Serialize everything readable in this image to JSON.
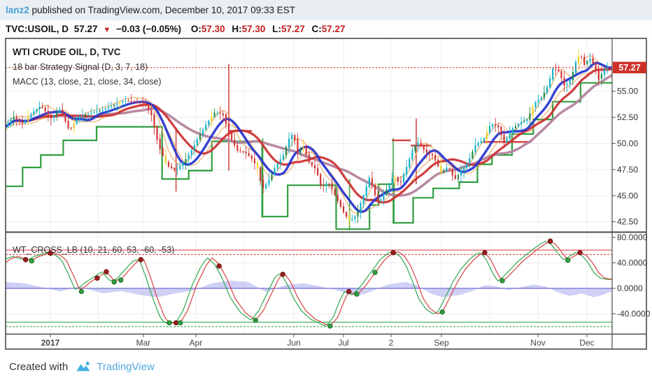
{
  "header": {
    "username": "lanz2",
    "published_text": " published on TradingView.com, December 10, 2017 09:33 EST"
  },
  "ticker": {
    "symbol": "TVC:USOIL, D",
    "last": "57.27",
    "direction": "▼",
    "change": "−0.03 (−0.05%)",
    "open_label": "O:",
    "open": "57.30",
    "high_label": "H:",
    "high": "57.30",
    "low_label": "L:",
    "low": "57.27",
    "close_label": "C:",
    "close": "57.27"
  },
  "footer": {
    "created_with": "Created with",
    "brand": "TradingView"
  },
  "colors": {
    "accent_red": "#c51f1f",
    "badge_red": "#cf3129",
    "up_teal": "#12b2ca",
    "up_green": "#1e8c4f",
    "down_red": "#d23535",
    "yellow": "#f2d024",
    "ma_fast_blue": "#2433cf",
    "ma_mid_red": "#cf3333",
    "ma_slow_plum": "#b5849e",
    "stop_green": "#2f9e3f",
    "ribbon_orange": "#eba55a",
    "osc_green": "#3fae5a",
    "osc_red": "#d94f4f",
    "osc_zero": "#8080d8",
    "osc_area": "#a9a9ee",
    "dot_red": "#9b1c1c",
    "dot_green": "#2f9e3f",
    "grid": "#ececec",
    "frame": "#4a4a4a",
    "label": "#333333"
  },
  "chart_data": [
    {
      "type": "candlestick",
      "panel": "main",
      "legend": [
        "WTI CRUDE OIL, D, TVC",
        "18 bar Strategy Signal (D, 3, 7, 18)",
        "MACC (13, close, 21, close, 34, close)"
      ],
      "ylim": [
        41.7,
        60.1
      ],
      "y_ticks": [
        55.0,
        52.5,
        50.0,
        47.5,
        45.0,
        42.5
      ],
      "y_tick_labels": [
        "55.00",
        "52.50",
        "50.00",
        "47.50",
        "45.00",
        "42.50"
      ],
      "x_ticks": [
        {
          "label": "2017",
          "f": 0.0738,
          "bold": true
        },
        {
          "label": "Mar",
          "f": 0.2272,
          "bold": false
        },
        {
          "label": "Apr",
          "f": 0.3137,
          "bold": false
        },
        {
          "label": "Jun",
          "f": 0.4752,
          "bold": false
        },
        {
          "label": "Jul",
          "f": 0.5571,
          "bold": false
        },
        {
          "label": "2",
          "f": 0.6355,
          "bold": false
        },
        {
          "label": "Sep",
          "f": 0.7186,
          "bold": false
        },
        {
          "label": "Nov",
          "f": 0.8777,
          "bold": false
        },
        {
          "label": "Dec",
          "f": 0.9585,
          "bold": false
        }
      ],
      "x_grid": [
        0.0738,
        0.1522,
        0.2272,
        0.3137,
        0.3933,
        0.4752,
        0.5571,
        0.6355,
        0.7186,
        0.7982,
        0.8777,
        0.9585
      ],
      "price_line": {
        "value": 57.27,
        "label": "57.27"
      },
      "bar_count": 210,
      "wiggle": [
        0.55,
        0.2,
        0.8,
        0.35,
        0.15,
        0.65,
        0.3,
        0.9,
        0.25,
        0.45,
        0.1,
        0.7
      ],
      "close_path": [
        [
          0.0,
          51.6
        ],
        [
          0.012,
          52.6
        ],
        [
          0.028,
          51.9
        ],
        [
          0.045,
          53.0
        ],
        [
          0.058,
          53.6
        ],
        [
          0.075,
          52.4
        ],
        [
          0.09,
          53.3
        ],
        [
          0.105,
          51.2
        ],
        [
          0.12,
          52.6
        ],
        [
          0.14,
          52.9
        ],
        [
          0.158,
          53.2
        ],
        [
          0.175,
          53.6
        ],
        [
          0.195,
          54.1
        ],
        [
          0.21,
          54.0
        ],
        [
          0.227,
          53.9
        ],
        [
          0.24,
          52.8
        ],
        [
          0.252,
          49.8
        ],
        [
          0.266,
          47.9
        ],
        [
          0.28,
          47.4
        ],
        [
          0.295,
          48.3
        ],
        [
          0.31,
          49.7
        ],
        [
          0.314,
          50.2
        ],
        [
          0.33,
          51.8
        ],
        [
          0.345,
          53.0
        ],
        [
          0.358,
          52.8
        ],
        [
          0.37,
          50.6
        ],
        [
          0.382,
          49.3
        ],
        [
          0.394,
          49.2
        ],
        [
          0.405,
          48.6
        ],
        [
          0.415,
          47.7
        ],
        [
          0.423,
          45.6
        ],
        [
          0.432,
          46.3
        ],
        [
          0.445,
          47.8
        ],
        [
          0.458,
          48.9
        ],
        [
          0.468,
          50.6
        ],
        [
          0.475,
          51.0
        ],
        [
          0.48,
          48.9
        ],
        [
          0.49,
          49.8
        ],
        [
          0.5,
          48.2
        ],
        [
          0.512,
          47.5
        ],
        [
          0.52,
          45.8
        ],
        [
          0.532,
          46.3
        ],
        [
          0.545,
          44.8
        ],
        [
          0.558,
          43.3
        ],
        [
          0.567,
          42.6
        ],
        [
          0.578,
          43.1
        ],
        [
          0.59,
          45.0
        ],
        [
          0.6,
          46.8
        ],
        [
          0.608,
          45.2
        ],
        [
          0.615,
          44.3
        ],
        [
          0.628,
          45.6
        ],
        [
          0.64,
          46.9
        ],
        [
          0.65,
          46.1
        ],
        [
          0.662,
          47.9
        ],
        [
          0.672,
          49.6
        ],
        [
          0.68,
          50.1
        ],
        [
          0.692,
          49.2
        ],
        [
          0.705,
          48.8
        ],
        [
          0.718,
          47.2
        ],
        [
          0.73,
          47.8
        ],
        [
          0.74,
          46.5
        ],
        [
          0.75,
          47.3
        ],
        [
          0.762,
          48.2
        ],
        [
          0.775,
          49.9
        ],
        [
          0.788,
          50.4
        ],
        [
          0.8,
          51.9
        ],
        [
          0.812,
          51.6
        ],
        [
          0.822,
          50.0
        ],
        [
          0.835,
          51.4
        ],
        [
          0.848,
          52.0
        ],
        [
          0.86,
          52.3
        ],
        [
          0.872,
          53.9
        ],
        [
          0.884,
          54.4
        ],
        [
          0.895,
          55.7
        ],
        [
          0.902,
          57.2
        ],
        [
          0.912,
          56.9
        ],
        [
          0.922,
          55.4
        ],
        [
          0.932,
          56.2
        ],
        [
          0.94,
          57.8
        ],
        [
          0.947,
          58.6
        ],
        [
          0.955,
          57.4
        ],
        [
          0.962,
          58.3
        ],
        [
          0.97,
          57.5
        ],
        [
          0.978,
          56.1
        ],
        [
          0.988,
          57.3
        ],
        [
          1.0,
          57.27
        ]
      ],
      "green_stop_steps": [
        [
          0.0,
          45.9
        ],
        [
          0.028,
          47.7
        ],
        [
          0.058,
          48.9
        ],
        [
          0.095,
          50.3
        ],
        [
          0.15,
          51.6
        ],
        [
          0.258,
          46.6
        ],
        [
          0.302,
          47.4
        ],
        [
          0.34,
          50.2
        ],
        [
          0.423,
          43.0
        ],
        [
          0.465,
          46.0
        ],
        [
          0.545,
          41.8
        ],
        [
          0.6,
          44.1
        ],
        [
          0.615,
          46.1
        ],
        [
          0.64,
          42.4
        ],
        [
          0.672,
          44.8
        ],
        [
          0.705,
          45.7
        ],
        [
          0.748,
          46.3
        ],
        [
          0.778,
          48.0
        ],
        [
          0.802,
          48.9
        ],
        [
          0.835,
          50.9
        ],
        [
          0.87,
          52.3
        ],
        [
          0.902,
          54.0
        ],
        [
          0.948,
          55.8
        ],
        [
          1.0,
          55.8
        ]
      ],
      "red_stop_segments": [
        [
          0.368,
          0.406,
          51.2
        ],
        [
          0.637,
          0.668,
          50.3
        ],
        [
          0.668,
          0.702,
          49.8
        ],
        [
          0.787,
          0.867,
          50.15
        ]
      ],
      "spikes": [
        [
          0.281,
          51.5,
          45.4,
          "down"
        ],
        [
          0.368,
          57.6,
          47.4,
          "down"
        ],
        [
          0.424,
          50.5,
          42.9,
          "up"
        ],
        [
          0.567,
          46.6,
          41.7,
          "up"
        ],
        [
          0.639,
          50.5,
          42.3,
          "up"
        ],
        [
          0.677,
          52.4,
          46.1,
          "down"
        ],
        [
          0.978,
          57.1,
          55.8,
          "up"
        ]
      ]
    },
    {
      "type": "line-oscillator",
      "panel": "lower",
      "legend": "WT_CROSS_LB (10, 21, 60, 53, -60, -53)",
      "ylim": [
        -70,
        86
      ],
      "y_ticks": [
        80,
        40,
        0,
        -40
      ],
      "y_tick_labels": [
        "80.0000",
        "40.0000",
        "0.0000",
        "-40.0000"
      ],
      "levels": {
        "upper": [
          60,
          53
        ],
        "zero": 0,
        "lower": [
          -53,
          -60
        ]
      },
      "wt_path": [
        [
          0.0,
          40
        ],
        [
          0.008,
          46
        ],
        [
          0.02,
          50
        ],
        [
          0.03,
          47
        ],
        [
          0.043,
          44
        ],
        [
          0.055,
          50
        ],
        [
          0.068,
          54
        ],
        [
          0.078,
          56
        ],
        [
          0.09,
          52
        ],
        [
          0.1,
          44
        ],
        [
          0.112,
          20
        ],
        [
          0.122,
          -2
        ],
        [
          0.13,
          2
        ],
        [
          0.14,
          10
        ],
        [
          0.152,
          17
        ],
        [
          0.166,
          26
        ],
        [
          0.172,
          20
        ],
        [
          0.179,
          12
        ],
        [
          0.19,
          14
        ],
        [
          0.205,
          30
        ],
        [
          0.218,
          43
        ],
        [
          0.228,
          45
        ],
        [
          0.238,
          20
        ],
        [
          0.25,
          -15
        ],
        [
          0.262,
          -45
        ],
        [
          0.27,
          -54
        ],
        [
          0.288,
          -54
        ],
        [
          0.3,
          -35
        ],
        [
          0.315,
          5
        ],
        [
          0.33,
          35
        ],
        [
          0.34,
          48
        ],
        [
          0.352,
          38
        ],
        [
          0.365,
          15
        ],
        [
          0.378,
          -15
        ],
        [
          0.395,
          -38
        ],
        [
          0.412,
          -50
        ],
        [
          0.425,
          -35
        ],
        [
          0.44,
          -5
        ],
        [
          0.452,
          18
        ],
        [
          0.46,
          23
        ],
        [
          0.47,
          10
        ],
        [
          0.482,
          -15
        ],
        [
          0.495,
          -35
        ],
        [
          0.51,
          -48
        ],
        [
          0.525,
          -55
        ],
        [
          0.535,
          -59
        ],
        [
          0.548,
          -45
        ],
        [
          0.558,
          -20
        ],
        [
          0.566,
          -5
        ],
        [
          0.572,
          -8
        ],
        [
          0.579,
          -10
        ],
        [
          0.59,
          0
        ],
        [
          0.602,
          15
        ],
        [
          0.612,
          28
        ],
        [
          0.625,
          45
        ],
        [
          0.639,
          56
        ],
        [
          0.648,
          57
        ],
        [
          0.658,
          50
        ],
        [
          0.668,
          35
        ],
        [
          0.678,
          12
        ],
        [
          0.688,
          -15
        ],
        [
          0.7,
          -32
        ],
        [
          0.712,
          -40
        ],
        [
          0.72,
          -37
        ],
        [
          0.732,
          -15
        ],
        [
          0.745,
          10
        ],
        [
          0.758,
          30
        ],
        [
          0.772,
          45
        ],
        [
          0.782,
          53
        ],
        [
          0.79,
          56
        ],
        [
          0.8,
          45
        ],
        [
          0.81,
          25
        ],
        [
          0.819,
          11
        ],
        [
          0.828,
          18
        ],
        [
          0.84,
          30
        ],
        [
          0.852,
          42
        ],
        [
          0.865,
          52
        ],
        [
          0.878,
          62
        ],
        [
          0.89,
          70
        ],
        [
          0.898,
          74
        ],
        [
          0.908,
          68
        ],
        [
          0.918,
          55
        ],
        [
          0.927,
          45
        ],
        [
          0.937,
          50
        ],
        [
          0.947,
          56
        ],
        [
          0.957,
          52
        ],
        [
          0.968,
          40
        ],
        [
          0.978,
          24
        ],
        [
          0.988,
          16
        ],
        [
          1.0,
          14
        ]
      ],
      "area_path": [
        [
          0.0,
          10
        ],
        [
          0.03,
          8
        ],
        [
          0.06,
          2
        ],
        [
          0.09,
          -5
        ],
        [
          0.12,
          3
        ],
        [
          0.16,
          -8
        ],
        [
          0.19,
          -4
        ],
        [
          0.22,
          -10
        ],
        [
          0.25,
          -14
        ],
        [
          0.28,
          -8
        ],
        [
          0.31,
          -3
        ],
        [
          0.34,
          8
        ],
        [
          0.37,
          12
        ],
        [
          0.4,
          10
        ],
        [
          0.43,
          -6
        ],
        [
          0.46,
          5
        ],
        [
          0.49,
          8
        ],
        [
          0.52,
          3
        ],
        [
          0.55,
          -4
        ],
        [
          0.58,
          -12
        ],
        [
          0.6,
          -6
        ],
        [
          0.63,
          6
        ],
        [
          0.66,
          10
        ],
        [
          0.68,
          4
        ],
        [
          0.7,
          -8
        ],
        [
          0.72,
          -14
        ],
        [
          0.75,
          -10
        ],
        [
          0.77,
          -4
        ],
        [
          0.79,
          5
        ],
        [
          0.81,
          3
        ],
        [
          0.83,
          -3
        ],
        [
          0.85,
          2
        ],
        [
          0.87,
          6
        ],
        [
          0.89,
          3
        ],
        [
          0.91,
          -6
        ],
        [
          0.93,
          -12
        ],
        [
          0.95,
          -8
        ],
        [
          0.97,
          -14
        ],
        [
          0.985,
          -10
        ],
        [
          1.0,
          -4
        ]
      ],
      "dots_red": [
        [
          0.033,
          45
        ],
        [
          0.074,
          55
        ],
        [
          0.151,
          16
        ],
        [
          0.166,
          26
        ],
        [
          0.223,
          45
        ],
        [
          0.281,
          -54
        ],
        [
          0.352,
          35
        ],
        [
          0.457,
          22
        ],
        [
          0.566,
          -5
        ],
        [
          0.639,
          56
        ],
        [
          0.79,
          56
        ],
        [
          0.898,
          74
        ],
        [
          0.947,
          56
        ]
      ],
      "dots_green": [
        [
          0.043,
          43
        ],
        [
          0.125,
          -5
        ],
        [
          0.179,
          10
        ],
        [
          0.19,
          13
        ],
        [
          0.27,
          -54
        ],
        [
          0.288,
          -54
        ],
        [
          0.412,
          -50
        ],
        [
          0.535,
          -59
        ],
        [
          0.579,
          -9
        ],
        [
          0.609,
          25
        ],
        [
          0.72,
          -37
        ],
        [
          0.819,
          12
        ],
        [
          0.927,
          44
        ]
      ]
    }
  ]
}
